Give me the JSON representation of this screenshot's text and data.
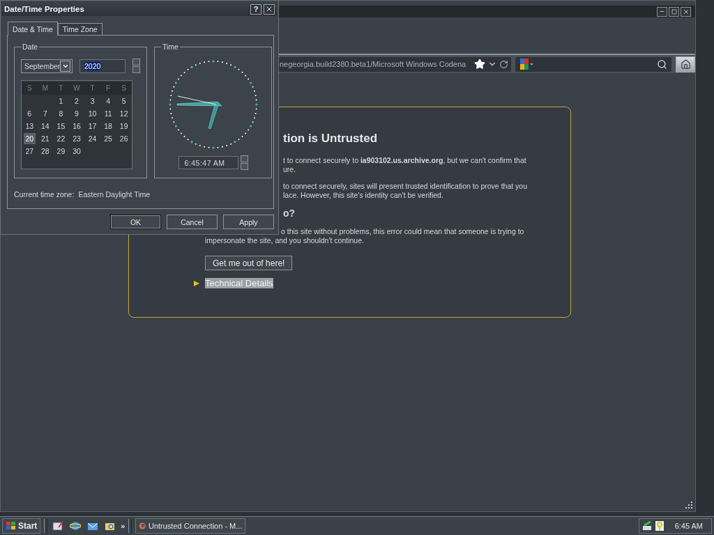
{
  "browser": {
    "url": "negeorgia.build2380.beta1/Microsoft Windows Codena",
    "error_page": {
      "title": "tion is Untrusted",
      "upper_paragraphs": [
        "t to connect securely to **ia903102.us.archive.org**, but we can't confirm that\nure.",
        "to connect securely, sites will present trusted identification to prove that you\nlace. However, this site's identity can't be verified."
      ],
      "subheading": "o?",
      "lower_paragraph": [
        "o this site without problems, this error could mean that someone is trying to",
        "impersonate the site, and you shouldn't continue."
      ],
      "button": "Get me out of here!",
      "details": {
        "label": "Technical Details",
        "highlighted": true,
        "expanded": false
      }
    }
  },
  "dialog": {
    "title": "Date/Time Properties",
    "help": "?",
    "tabs": [
      {
        "label": "Date & Time",
        "selected": true
      },
      {
        "label": "Time Zone",
        "selected": false
      }
    ],
    "date_group": {
      "label": "Date",
      "month": "September",
      "year": "2020",
      "year_selected": true,
      "weekdays": [
        "S",
        "M",
        "T",
        "W",
        "T",
        "F",
        "S"
      ],
      "weeks": [
        [
          {
            "day": "1",
            "selected": false
          },
          {
            "day": "2",
            "selected": false
          },
          {
            "day": "3",
            "selected": false
          },
          {
            "day": "4",
            "selected": false
          },
          {
            "day": "5",
            "selected": false
          }
        ],
        [
          {
            "day": "6",
            "selected": false
          },
          {
            "day": "7",
            "selected": false
          },
          {
            "day": "8",
            "selected": false
          },
          {
            "day": "9",
            "selected": false
          },
          {
            "day": "10",
            "selected": false
          },
          {
            "day": "11",
            "selected": false
          },
          {
            "day": "12",
            "selected": false
          }
        ],
        [
          {
            "day": "13",
            "selected": false
          },
          {
            "day": "14",
            "selected": false
          },
          {
            "day": "15",
            "selected": false
          },
          {
            "day": "16",
            "selected": false
          },
          {
            "day": "17",
            "selected": false
          },
          {
            "day": "18",
            "selected": false
          },
          {
            "day": "19",
            "selected": false
          }
        ],
        [
          {
            "day": "20",
            "selected": true
          },
          {
            "day": "21",
            "selected": false
          },
          {
            "day": "22",
            "selected": false
          },
          {
            "day": "23",
            "selected": false
          },
          {
            "day": "24",
            "selected": false
          },
          {
            "day": "25",
            "selected": false
          },
          {
            "day": "26",
            "selected": false
          }
        ],
        [
          {
            "day": "27",
            "selected": false
          },
          {
            "day": "28",
            "selected": false
          },
          {
            "day": "29",
            "selected": false
          },
          {
            "day": "30",
            "selected": false
          }
        ]
      ]
    },
    "time_group": {
      "label": "Time",
      "time": "6:45:47 AM"
    },
    "time_zone_label": "Current time zone:",
    "time_zone": "Eastern Daylight Time",
    "buttons": [
      {
        "label": "OK",
        "default": true
      },
      {
        "label": "Cancel",
        "default": false
      },
      {
        "label": "Apply",
        "default": false
      }
    ]
  },
  "taskbar": {
    "start": "Start",
    "more": "»",
    "tasks": [
      {
        "label": "Untrusted Connection - M...",
        "selected": false
      }
    ],
    "clock": "6:45 AM"
  }
}
